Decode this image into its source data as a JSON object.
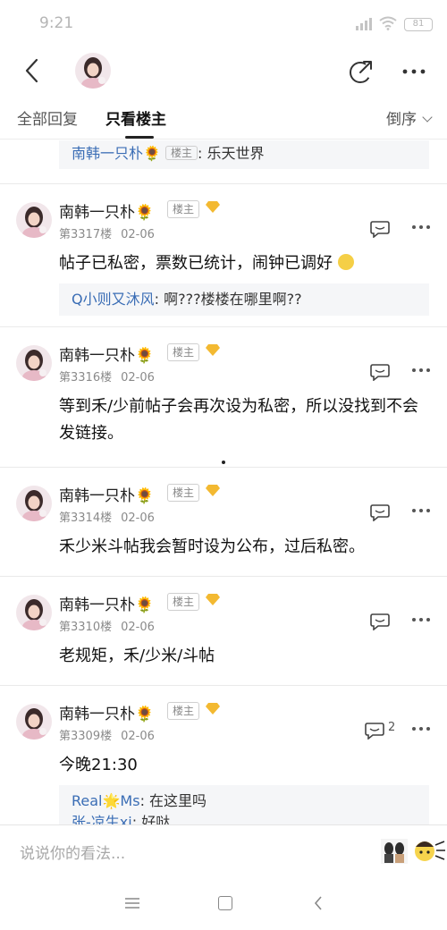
{
  "status": {
    "time": "9:21",
    "battery": "81"
  },
  "tabs": {
    "all": "全部回复",
    "op_only": "只看楼主",
    "sort": "倒序"
  },
  "top_quote": {
    "name": "南韩一只朴",
    "badge": "楼主",
    "sep": ":",
    "text": "乐天世界"
  },
  "posts": [
    {
      "name": "南韩一只朴",
      "badge": "楼主",
      "floor": "第3317楼",
      "date": "02-06",
      "body": "帖子已私密，票数已统计，闹钟已调好",
      "quotes": [
        {
          "name": "Q小则又沐风",
          "sep": ":",
          "text": "啊???楼楼在哪里啊??"
        }
      ]
    },
    {
      "name": "南韩一只朴",
      "badge": "楼主",
      "floor": "第3316楼",
      "date": "02-06",
      "body": "等到禾/少前帖子会再次设为私密，所以没找到不会发链接。"
    },
    {
      "name": "南韩一只朴",
      "badge": "楼主",
      "floor": "第3314楼",
      "date": "02-06",
      "body": "禾少米斗帖我会暂时设为公布，过后私密。"
    },
    {
      "name": "南韩一只朴",
      "badge": "楼主",
      "floor": "第3310楼",
      "date": "02-06",
      "body": "老规矩，禾/少米/斗帖"
    },
    {
      "name": "南韩一只朴",
      "badge": "楼主",
      "floor": "第3309楼",
      "date": "02-06",
      "reply_count": "2",
      "body": "今晚21:30",
      "quotes": [
        {
          "name": "Real🌟Ms",
          "sep": ":",
          "text": "在这里吗"
        },
        {
          "name": "张-凉生xi",
          "sep": ":",
          "text": "好哒"
        }
      ]
    }
  ],
  "input": {
    "placeholder": "说说你的看法..."
  },
  "colors": {
    "link": "#3a6db5",
    "level_badge": "#f3b931"
  }
}
